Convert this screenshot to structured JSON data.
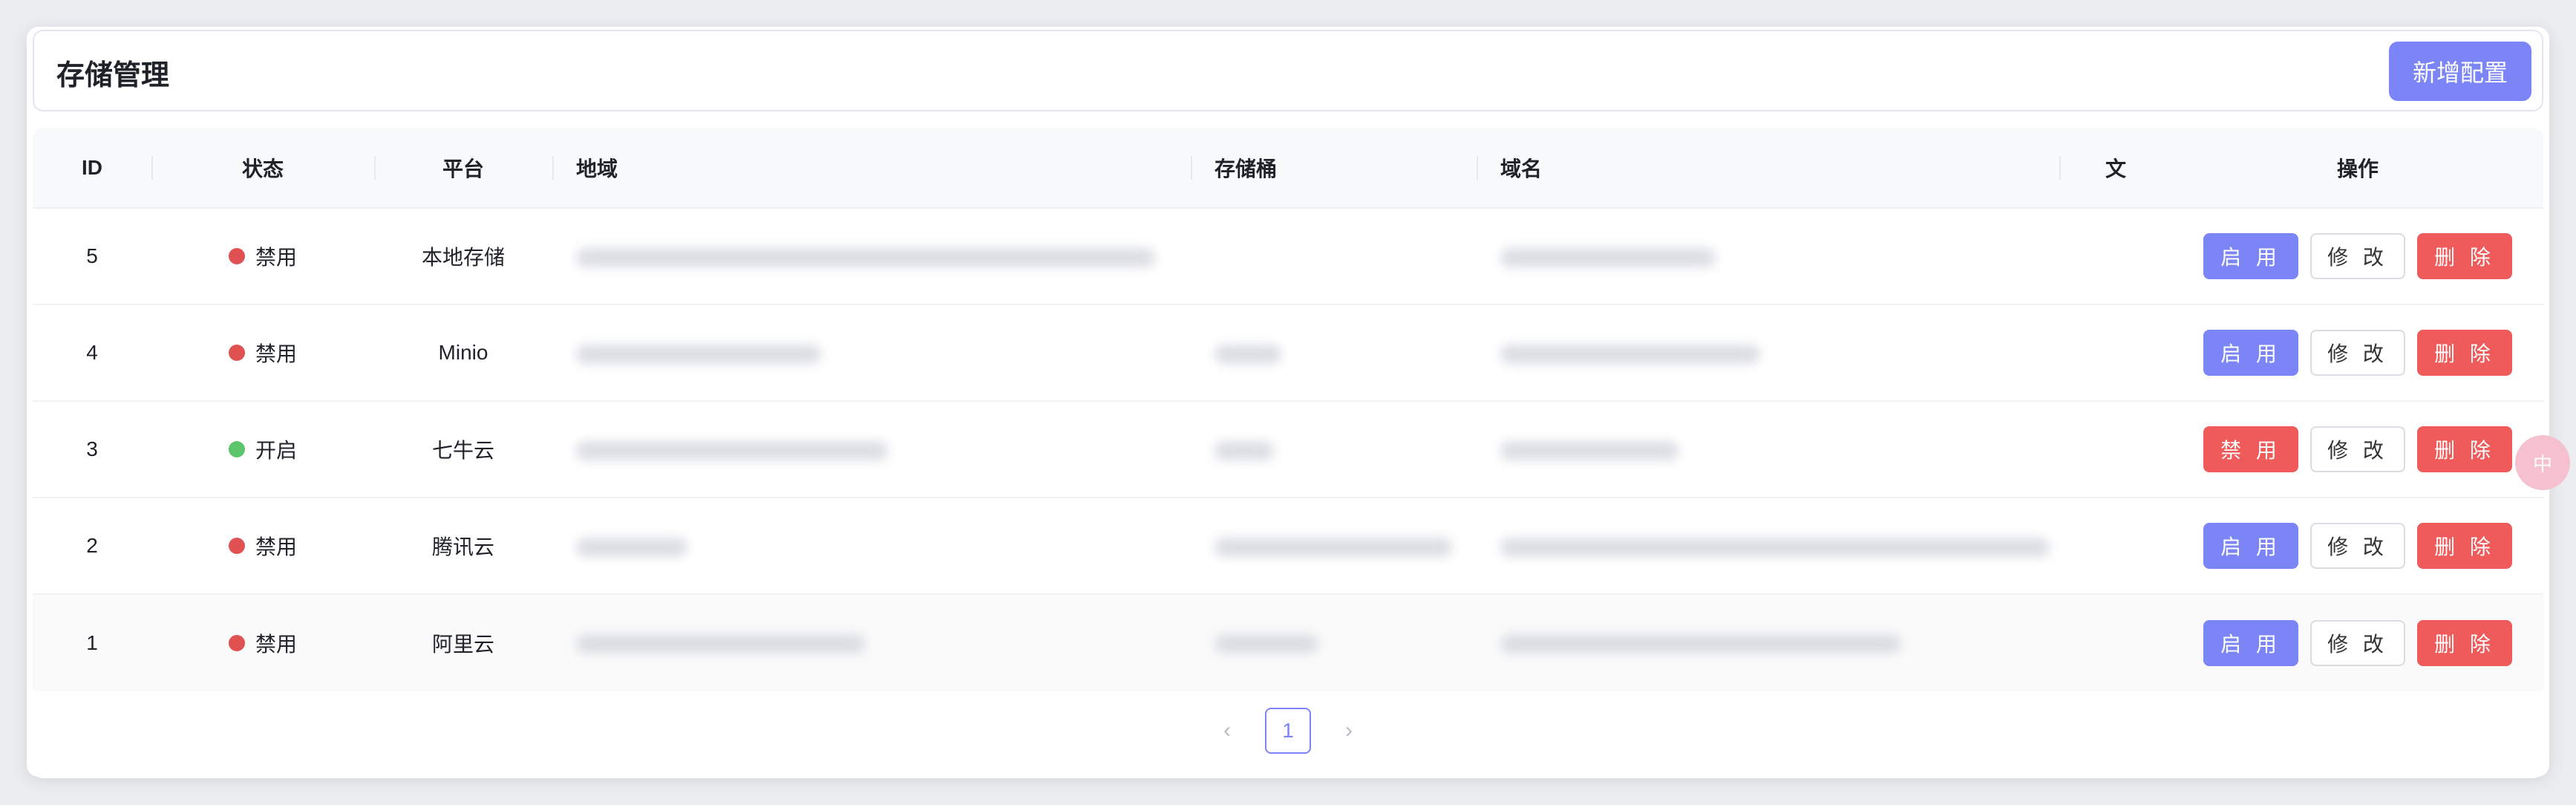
{
  "header": {
    "title": "存储管理",
    "add_button": "新增配置"
  },
  "table": {
    "columns": [
      "ID",
      "状态",
      "平台",
      "地域",
      "存储桶",
      "域名",
      "文",
      "操作"
    ],
    "rows": [
      {
        "id": "5",
        "status": "禁用",
        "status_color": "#e05252",
        "platform": "本地存储",
        "toggle": "启 用",
        "toggle_kind": "primary"
      },
      {
        "id": "4",
        "status": "禁用",
        "status_color": "#e05252",
        "platform": "Minio",
        "toggle": "启 用",
        "toggle_kind": "primary"
      },
      {
        "id": "3",
        "status": "开启",
        "status_color": "#5cc46a",
        "platform": "七牛云",
        "toggle": "禁 用",
        "toggle_kind": "danger"
      },
      {
        "id": "2",
        "status": "禁用",
        "status_color": "#e05252",
        "platform": "腾讯云",
        "toggle": "启 用",
        "toggle_kind": "primary"
      },
      {
        "id": "1",
        "status": "禁用",
        "status_color": "#e05252",
        "platform": "阿里云",
        "toggle": "启 用",
        "toggle_kind": "primary"
      }
    ],
    "edit_label": "修 改",
    "delete_label": "删 除"
  },
  "pagination": {
    "current": "1",
    "prev": "‹",
    "next": "›"
  },
  "floating": {
    "label": "中"
  },
  "colors": {
    "primary": "#7b85f5",
    "danger": "#ef5a5a",
    "enabled": "#5cc46a",
    "disabled": "#e05252"
  }
}
